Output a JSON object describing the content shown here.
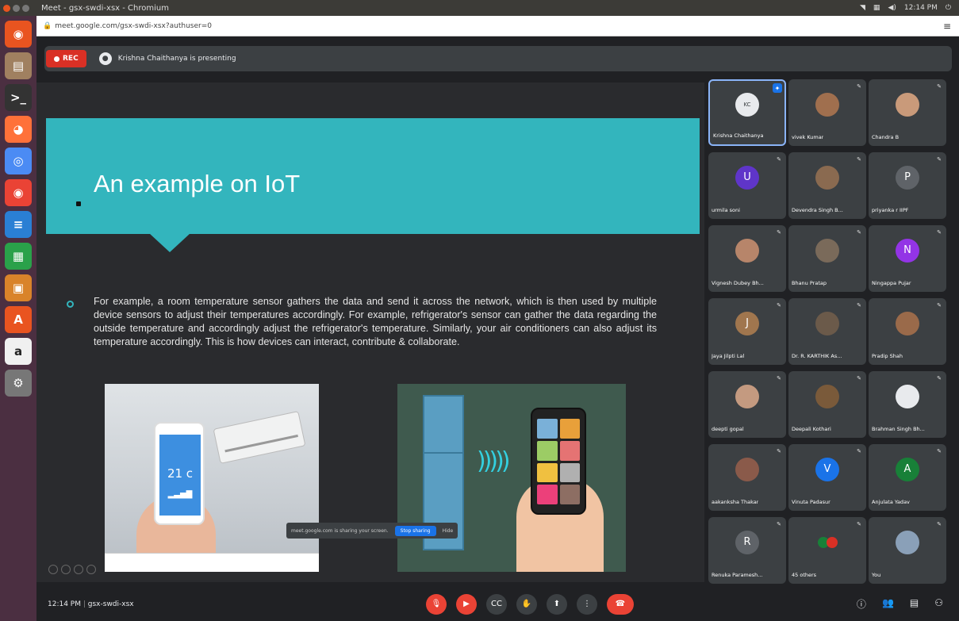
{
  "window": {
    "title": "Meet - gsx-swdi-xsx - Chromium"
  },
  "system_tray": {
    "time": "12:14 PM"
  },
  "browser": {
    "url": "meet.google.com/gsx-swdi-xsx?authuser=0"
  },
  "launcher": [
    {
      "icon": "ubuntu-dash-icon",
      "color": "#e95420",
      "glyph": "◉"
    },
    {
      "icon": "files-icon",
      "color": "#a08060",
      "glyph": "▤"
    },
    {
      "icon": "terminal-icon",
      "color": "#333333",
      "glyph": ">_"
    },
    {
      "icon": "firefox-icon",
      "color": "#ff7139",
      "glyph": "◕"
    },
    {
      "icon": "chromium-icon",
      "color": "#4b8bf4",
      "glyph": "◎"
    },
    {
      "icon": "chrome-icon",
      "color": "#ea4335",
      "glyph": "◉"
    },
    {
      "icon": "writer-icon",
      "color": "#2a7fd4",
      "glyph": "≡"
    },
    {
      "icon": "calc-icon",
      "color": "#2aa14a",
      "glyph": "▦"
    },
    {
      "icon": "impress-icon",
      "color": "#d9832a",
      "glyph": "▣"
    },
    {
      "icon": "software-center-icon",
      "color": "#e95420",
      "glyph": "A"
    },
    {
      "icon": "amazon-icon",
      "color": "#f0f0f0",
      "glyph": "a"
    },
    {
      "icon": "settings-icon",
      "color": "#777777",
      "glyph": "⚙"
    }
  ],
  "meet": {
    "recording_label": "REC",
    "presenting_text": "Krishna Chaithanya is presenting",
    "meeting_code": "gsx-swdi-xsx",
    "time": "12:14 PM",
    "share_bar": {
      "text": "meet.google.com is sharing your screen.",
      "stop": "Stop sharing",
      "hide": "Hide"
    }
  },
  "slide": {
    "title": "An example on IoT",
    "body": "For example, a room temperature sensor gathers the data and send it across the network, which is then used by multiple device sensors to adjust their temperatures accordingly. For example, refrigerator's sensor can gather the data regarding the outside temperature and accordingly adjust the refrigerator's temperature. Similarly, your air conditioners can also adjust its temperature accordingly. This is how devices can interact, contribute & collaborate.",
    "phone_temperature": "21 c",
    "accent_color": "#33b5bd"
  },
  "participants": [
    {
      "name": "Krishna Chaithanya",
      "initial": "KC",
      "color": "#e8eaed",
      "active": true
    },
    {
      "name": "vivek Kumar",
      "initial": "",
      "color": "#a06f4e"
    },
    {
      "name": "Chandra B",
      "initial": "",
      "color": "#c99a7a"
    },
    {
      "name": "urmila soni",
      "initial": "U",
      "color": "#5f35c9"
    },
    {
      "name": "Devendra Singh B...",
      "initial": "",
      "color": "#8a6a50"
    },
    {
      "name": "priyanka r IIPF",
      "initial": "P",
      "color": "#5f6368"
    },
    {
      "name": "Vignesh Dubey Bh...",
      "initial": "",
      "color": "#b7856a"
    },
    {
      "name": "Bhanu Pratap",
      "initial": "",
      "color": "#7a6a5a"
    },
    {
      "name": "Ningappa Pujar",
      "initial": "N",
      "color": "#9334e6"
    },
    {
      "name": "Jaya Jilpti Lal",
      "initial": "J",
      "color": "#a0764e"
    },
    {
      "name": "Dr. R. KARTHIK As...",
      "initial": "",
      "color": "#6b5a4a"
    },
    {
      "name": "Pradip Shah",
      "initial": "",
      "color": "#9a6a4a"
    },
    {
      "name": "deepti gopal",
      "initial": "",
      "color": "#c49a80"
    },
    {
      "name": "Deepali Kothari",
      "initial": "",
      "color": "#7a5a3a"
    },
    {
      "name": "Brahman Singh Bh...",
      "initial": "",
      "color": "#e8eaed"
    },
    {
      "name": "aakanksha Thakar",
      "initial": "",
      "color": "#8a5a4a"
    },
    {
      "name": "Vinuta Padasur",
      "initial": "V",
      "color": "#1a73e8"
    },
    {
      "name": "Anjulata Yadav",
      "initial": "A",
      "color": "#188038"
    },
    {
      "name": "Renuka Paramesh...",
      "initial": "R",
      "color": "#5f6368"
    },
    {
      "name": "45 others",
      "initial": "",
      "color": "#3c4043",
      "others": true
    },
    {
      "name": "You",
      "initial": "",
      "color": "#8aa0b8"
    }
  ],
  "controls": [
    {
      "name": "mic-button",
      "icon": "mic-off-icon",
      "glyph": "🎙",
      "red": true
    },
    {
      "name": "camera-button",
      "icon": "camera-off-icon",
      "glyph": "▶",
      "red": true
    },
    {
      "name": "captions-button",
      "icon": "captions-icon",
      "glyph": "CC"
    },
    {
      "name": "raise-hand-button",
      "icon": "hand-icon",
      "glyph": "✋"
    },
    {
      "name": "present-button",
      "icon": "present-icon",
      "glyph": "⬆"
    },
    {
      "name": "more-options-button",
      "icon": "more-vert-icon",
      "glyph": "⋮"
    },
    {
      "name": "leave-call-button",
      "icon": "hang-up-icon",
      "glyph": "☎",
      "hang": true
    }
  ],
  "right_controls": [
    {
      "name": "meeting-details-button",
      "icon": "info-icon",
      "glyph": "ⓘ"
    },
    {
      "name": "people-button",
      "icon": "people-icon",
      "glyph": "👥"
    },
    {
      "name": "chat-button",
      "icon": "chat-icon",
      "glyph": "▤"
    },
    {
      "name": "activities-button",
      "icon": "activities-icon",
      "glyph": "⚇"
    }
  ]
}
